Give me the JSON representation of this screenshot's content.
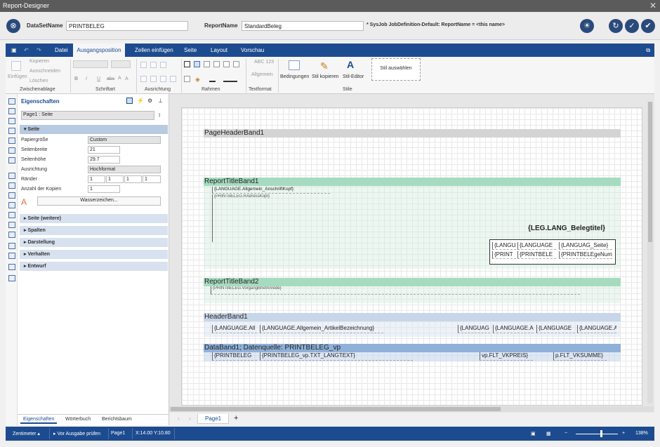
{
  "window": {
    "title": "Report-Designer",
    "close": "✕"
  },
  "header": {
    "dataset_label": "DataSetName",
    "dataset_value": "PRINTBELEG",
    "report_label": "ReportName",
    "report_value": "StandardBeleg",
    "hint": "* SysJob JobDefinition-Default: ReportName = <this name>"
  },
  "menu": {
    "tabs": [
      "Datei",
      "Ausgangsposition",
      "Zellen einfügen",
      "Seite",
      "Layout",
      "Vorschau"
    ],
    "active": "Ausgangsposition"
  },
  "ribbon": {
    "clipboard": {
      "paste": "Einfügen",
      "copy": "Kopieren",
      "cut": "Ausschneiden",
      "delete": "Löschen",
      "group": "Zwischenablage"
    },
    "font": {
      "bold": "B",
      "italic": "I",
      "underline": "U",
      "strike": "abc",
      "grow": "A",
      "shrink": "A",
      "group": "Schriftart"
    },
    "alignment": {
      "group": "Ausrichtung"
    },
    "borders": {
      "group": "Rahmen"
    },
    "textformat": {
      "sample": "ABC 123",
      "label": "Allgemein",
      "group": "Textformat"
    },
    "styles": {
      "conditions": "Bedingungen",
      "copy_style": "Stil kopieren",
      "style_editor": "Stil-Editor",
      "select_style": "Stil auswählen",
      "group": "Stile"
    }
  },
  "properties": {
    "title": "Eigenschaften",
    "selector": "Page1 : Seite",
    "section_page": "Seite",
    "rows": {
      "paper_size_label": "Papiergröße",
      "paper_size_value": "Custom",
      "width_label": "Seitenbreite",
      "width_value": "21",
      "height_label": "Seitenhöhe",
      "height_value": "29.7",
      "orientation_label": "Ausrichtung",
      "orientation_value": "Hochformat",
      "margins_label": "Ränder",
      "margin_1": "1",
      "margin_2": "1",
      "margin_3": "1",
      "margin_4": "1",
      "copies_label": "Anzahl der Kopien",
      "copies_value": "1",
      "watermark_button": "Wasserzeichen..."
    },
    "sections": [
      "Seite (weitere)",
      "Spalten",
      "Darstellung",
      "Verhalten",
      "Entwurf"
    ],
    "tabs": [
      "Eigenschaften",
      "Wörterbuch",
      "Berichtsbaum"
    ]
  },
  "canvas": {
    "bands": {
      "page_header": "PageHeaderBand1",
      "title1": "ReportTitleBand1",
      "title2": "ReportTitleBand2",
      "header1": "HeaderBand1",
      "data1": "DataBand1; Datenquelle: PRINTBELEG_vp"
    },
    "fields": {
      "anschrift": "{LANGUAGE.Allgemein_AnschriftKopf}",
      "adresskopf": "{PRINTBELEG.RAdressKopf}",
      "belegtitel": "{LEG.LANG_Belegtitel}",
      "box_r1c1": "{LANGUAGE",
      "box_r1c2": "{LANGUAGE",
      "box_r1c3": "{LANGUAG_Seite}",
      "box_r2c1": "{PRINT",
      "box_r2c2": "{PRINTBELE",
      "box_r2c3": "{PRINTBELEgeNumr",
      "vorgangbrief": "{PRINTBELEG.VorgangBriefAnrede}",
      "h_c1": "{LANGUAGE.All",
      "h_c2": "{LANGUAGE.Allgemein_ArtikelBezeichnung}",
      "h_c3": "{LANGUAG",
      "h_c4": "{LANGUAGE.A",
      "h_c5": "{LANGUAGE",
      "h_c6": "{LANGUAGE.A",
      "d_c1": "{PRINTBELEG",
      "d_c2": "{PRINTBELEG_vp.TXT_LANGTEXT}",
      "d_c3": "vp.FLT_VKPREIS}",
      "d_c4": "p.FLT_VKSUMME}"
    },
    "page_tab": "Page1",
    "add_tab": "+"
  },
  "status": {
    "unit": "Zentimeter",
    "check": "Vor Ausgabe prüfen",
    "page": "Page1",
    "coords": "X:14.00 Y:10.80",
    "zoom": "138%",
    "zoom_minus": "−",
    "zoom_plus": "+"
  }
}
